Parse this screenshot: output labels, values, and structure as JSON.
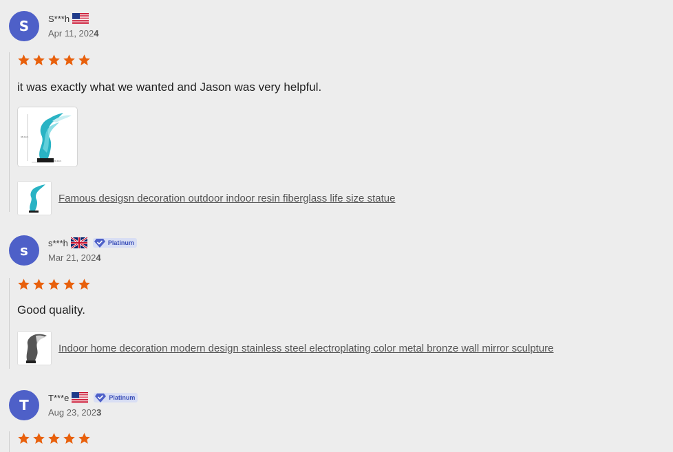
{
  "reviews": [
    {
      "initial": "S",
      "name": "S***h",
      "flag": "us",
      "badge": "",
      "date_prefix": "Apr 11, 202",
      "date_last": "4",
      "rating": 5,
      "text": "it was exactly what we wanted and Jason was very helpful.",
      "has_photo": true,
      "product": "Famous desigsn decoration outdoor indoor resin fiberglass life size statue"
    },
    {
      "initial": "s",
      "name": "s***h",
      "flag": "uk",
      "badge": "Platinum",
      "date_prefix": "Mar 21, 202",
      "date_last": "4",
      "rating": 5,
      "text": "Good quality.",
      "has_photo": false,
      "product": "Indoor home decoration modern design stainless steel electroplating color metal bronze wall mirror sculpture"
    },
    {
      "initial": "T",
      "name": "T***e",
      "flag": "us",
      "badge": "Platinum",
      "date_prefix": "Aug 23, 202",
      "date_last": "3",
      "rating": 5
    }
  ],
  "colors": {
    "avatar": "#4e60c8",
    "star": "#e8600c",
    "badge_bg": "#d8def4",
    "badge_text": "#3b4fb8"
  },
  "icons": {
    "star": "star-icon",
    "platinum": "diamond-check-icon"
  }
}
